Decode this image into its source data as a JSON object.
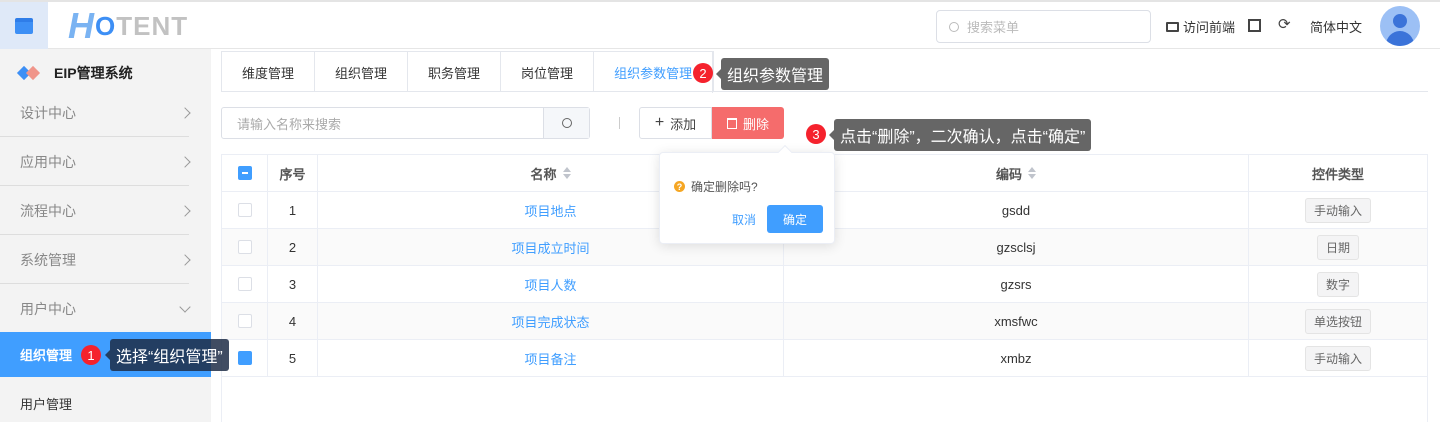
{
  "header": {
    "logo_h": "H",
    "logo_o": "O",
    "logo_rest": "TENT",
    "search_placeholder": "搜索菜单",
    "visit_frontend": "访问前端",
    "language": "简体中文"
  },
  "sidebar": {
    "system_title": "EIP管理系统",
    "items": [
      {
        "label": "设计中心"
      },
      {
        "label": "应用中心"
      },
      {
        "label": "流程中心"
      },
      {
        "label": "系统管理"
      },
      {
        "label": "用户中心"
      }
    ],
    "active_item": "组织管理",
    "sub_item": "用户管理"
  },
  "tabs": [
    {
      "label": "维度管理"
    },
    {
      "label": "组织管理"
    },
    {
      "label": "职务管理"
    },
    {
      "label": "岗位管理"
    },
    {
      "label": "组织参数管理"
    }
  ],
  "toolbar": {
    "search_placeholder": "请输入名称来搜索",
    "add_label": "添加",
    "delete_label": "删除"
  },
  "table": {
    "headers": [
      "序号",
      "名称",
      "编码",
      "控件类型"
    ],
    "rows": [
      {
        "no": "1",
        "name": "项目地点",
        "code": "gsdd",
        "type": "手动输入",
        "checked": false
      },
      {
        "no": "2",
        "name": "项目成立时间",
        "code": "gzsclsj",
        "type": "日期",
        "checked": false
      },
      {
        "no": "3",
        "name": "项目人数",
        "code": "gzsrs",
        "type": "数字",
        "checked": false
      },
      {
        "no": "4",
        "name": "项目完成状态",
        "code": "xmsfwc",
        "type": "单选按钮",
        "checked": false
      },
      {
        "no": "5",
        "name": "项目备注",
        "code": "xmbz",
        "type": "手动输入",
        "checked": true
      }
    ]
  },
  "popover": {
    "message": "确定删除吗?",
    "cancel": "取消",
    "confirm": "确定"
  },
  "annotations": [
    {
      "num": "1",
      "text": "选择“组织管理”"
    },
    {
      "num": "2",
      "text": "组织参数管理"
    },
    {
      "num": "3",
      "text": "点击“删除”，二次确认，点击“确定”"
    }
  ],
  "colors": {
    "primary": "#409eff",
    "danger": "#f56c6c",
    "badge": "#f5222d"
  }
}
